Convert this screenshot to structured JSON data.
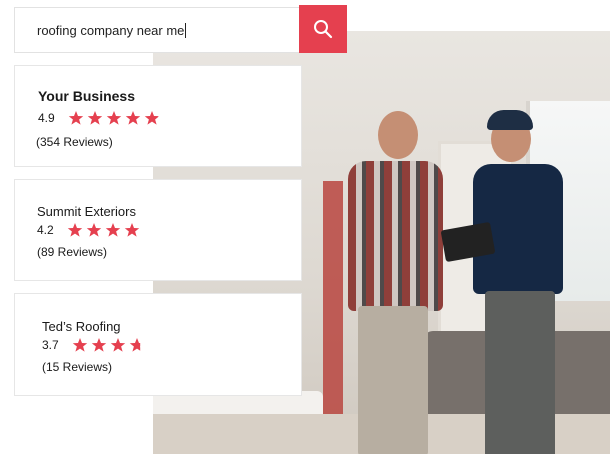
{
  "search": {
    "query": "roofing company near me",
    "icon": "search-icon"
  },
  "colors": {
    "accent": "#e5404f",
    "star": "#e5404f",
    "text": "#1a1a1a"
  },
  "results": [
    {
      "name": "Your Business",
      "rating_text": "4.9",
      "rating": 4.9,
      "reviews": "(354 Reviews)"
    },
    {
      "name": "Summit Exteriors",
      "rating_text": "4.2",
      "rating": 4.2,
      "reviews": "(89 Reviews)"
    },
    {
      "name": "Ted’s Roofing",
      "rating_text": "3.7",
      "rating": 3.7,
      "reviews": "(15 Reviews)"
    }
  ]
}
